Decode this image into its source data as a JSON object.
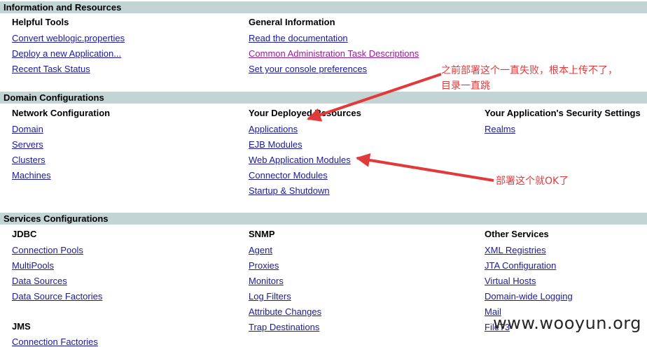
{
  "sections": {
    "info": {
      "title": "Information and Resources",
      "helpful_tools": {
        "title": "Helpful Tools",
        "links": [
          "Convert weblogic.properties",
          "Deploy a new Application...",
          "Recent Task Status"
        ]
      },
      "general_info": {
        "title": "General Information",
        "links": [
          "Read the documentation",
          "Common Administration Task Descriptions",
          "Set your console preferences"
        ]
      }
    },
    "domain": {
      "title": "Domain Configurations",
      "network": {
        "title": "Network Configuration",
        "links": [
          "Domain",
          "Servers",
          "Clusters",
          "Machines"
        ]
      },
      "deployed": {
        "title": "Your Deployed Resources",
        "links": [
          "Applications",
          "EJB Modules",
          "Web Application Modules",
          "Connector Modules",
          "Startup & Shutdown"
        ]
      },
      "security": {
        "title": "Your Application's Security Settings",
        "links": [
          "Realms"
        ]
      }
    },
    "services": {
      "title": "Services Configurations",
      "jdbc": {
        "title": "JDBC",
        "links": [
          "Connection Pools",
          "MultiPools",
          "Data Sources",
          "Data Source Factories"
        ]
      },
      "jms": {
        "title": "JMS",
        "links": [
          "Connection Factories"
        ]
      },
      "snmp": {
        "title": "SNMP",
        "links": [
          "Agent",
          "Proxies",
          "Monitors",
          "Log Filters",
          "Attribute Changes",
          "Trap Destinations"
        ]
      },
      "other": {
        "title": "Other Services",
        "links": [
          "XML Registries",
          "JTA Configuration",
          "Virtual Hosts",
          "Domain-wide Logging",
          "Mail",
          "FileT3"
        ]
      }
    }
  },
  "annotations": {
    "note_fail_line1": "之前部署这个一直失败，根本上传不了，",
    "note_fail_line2": "目录一直跳",
    "note_ok": "部署这个就OK了",
    "arrow_color": "#e03a3a"
  },
  "watermark": "www.wooyun.org",
  "colors": {
    "band": "#c2d4d4",
    "link": "#1a1a9c",
    "visited_link": "#9c1a9c"
  }
}
